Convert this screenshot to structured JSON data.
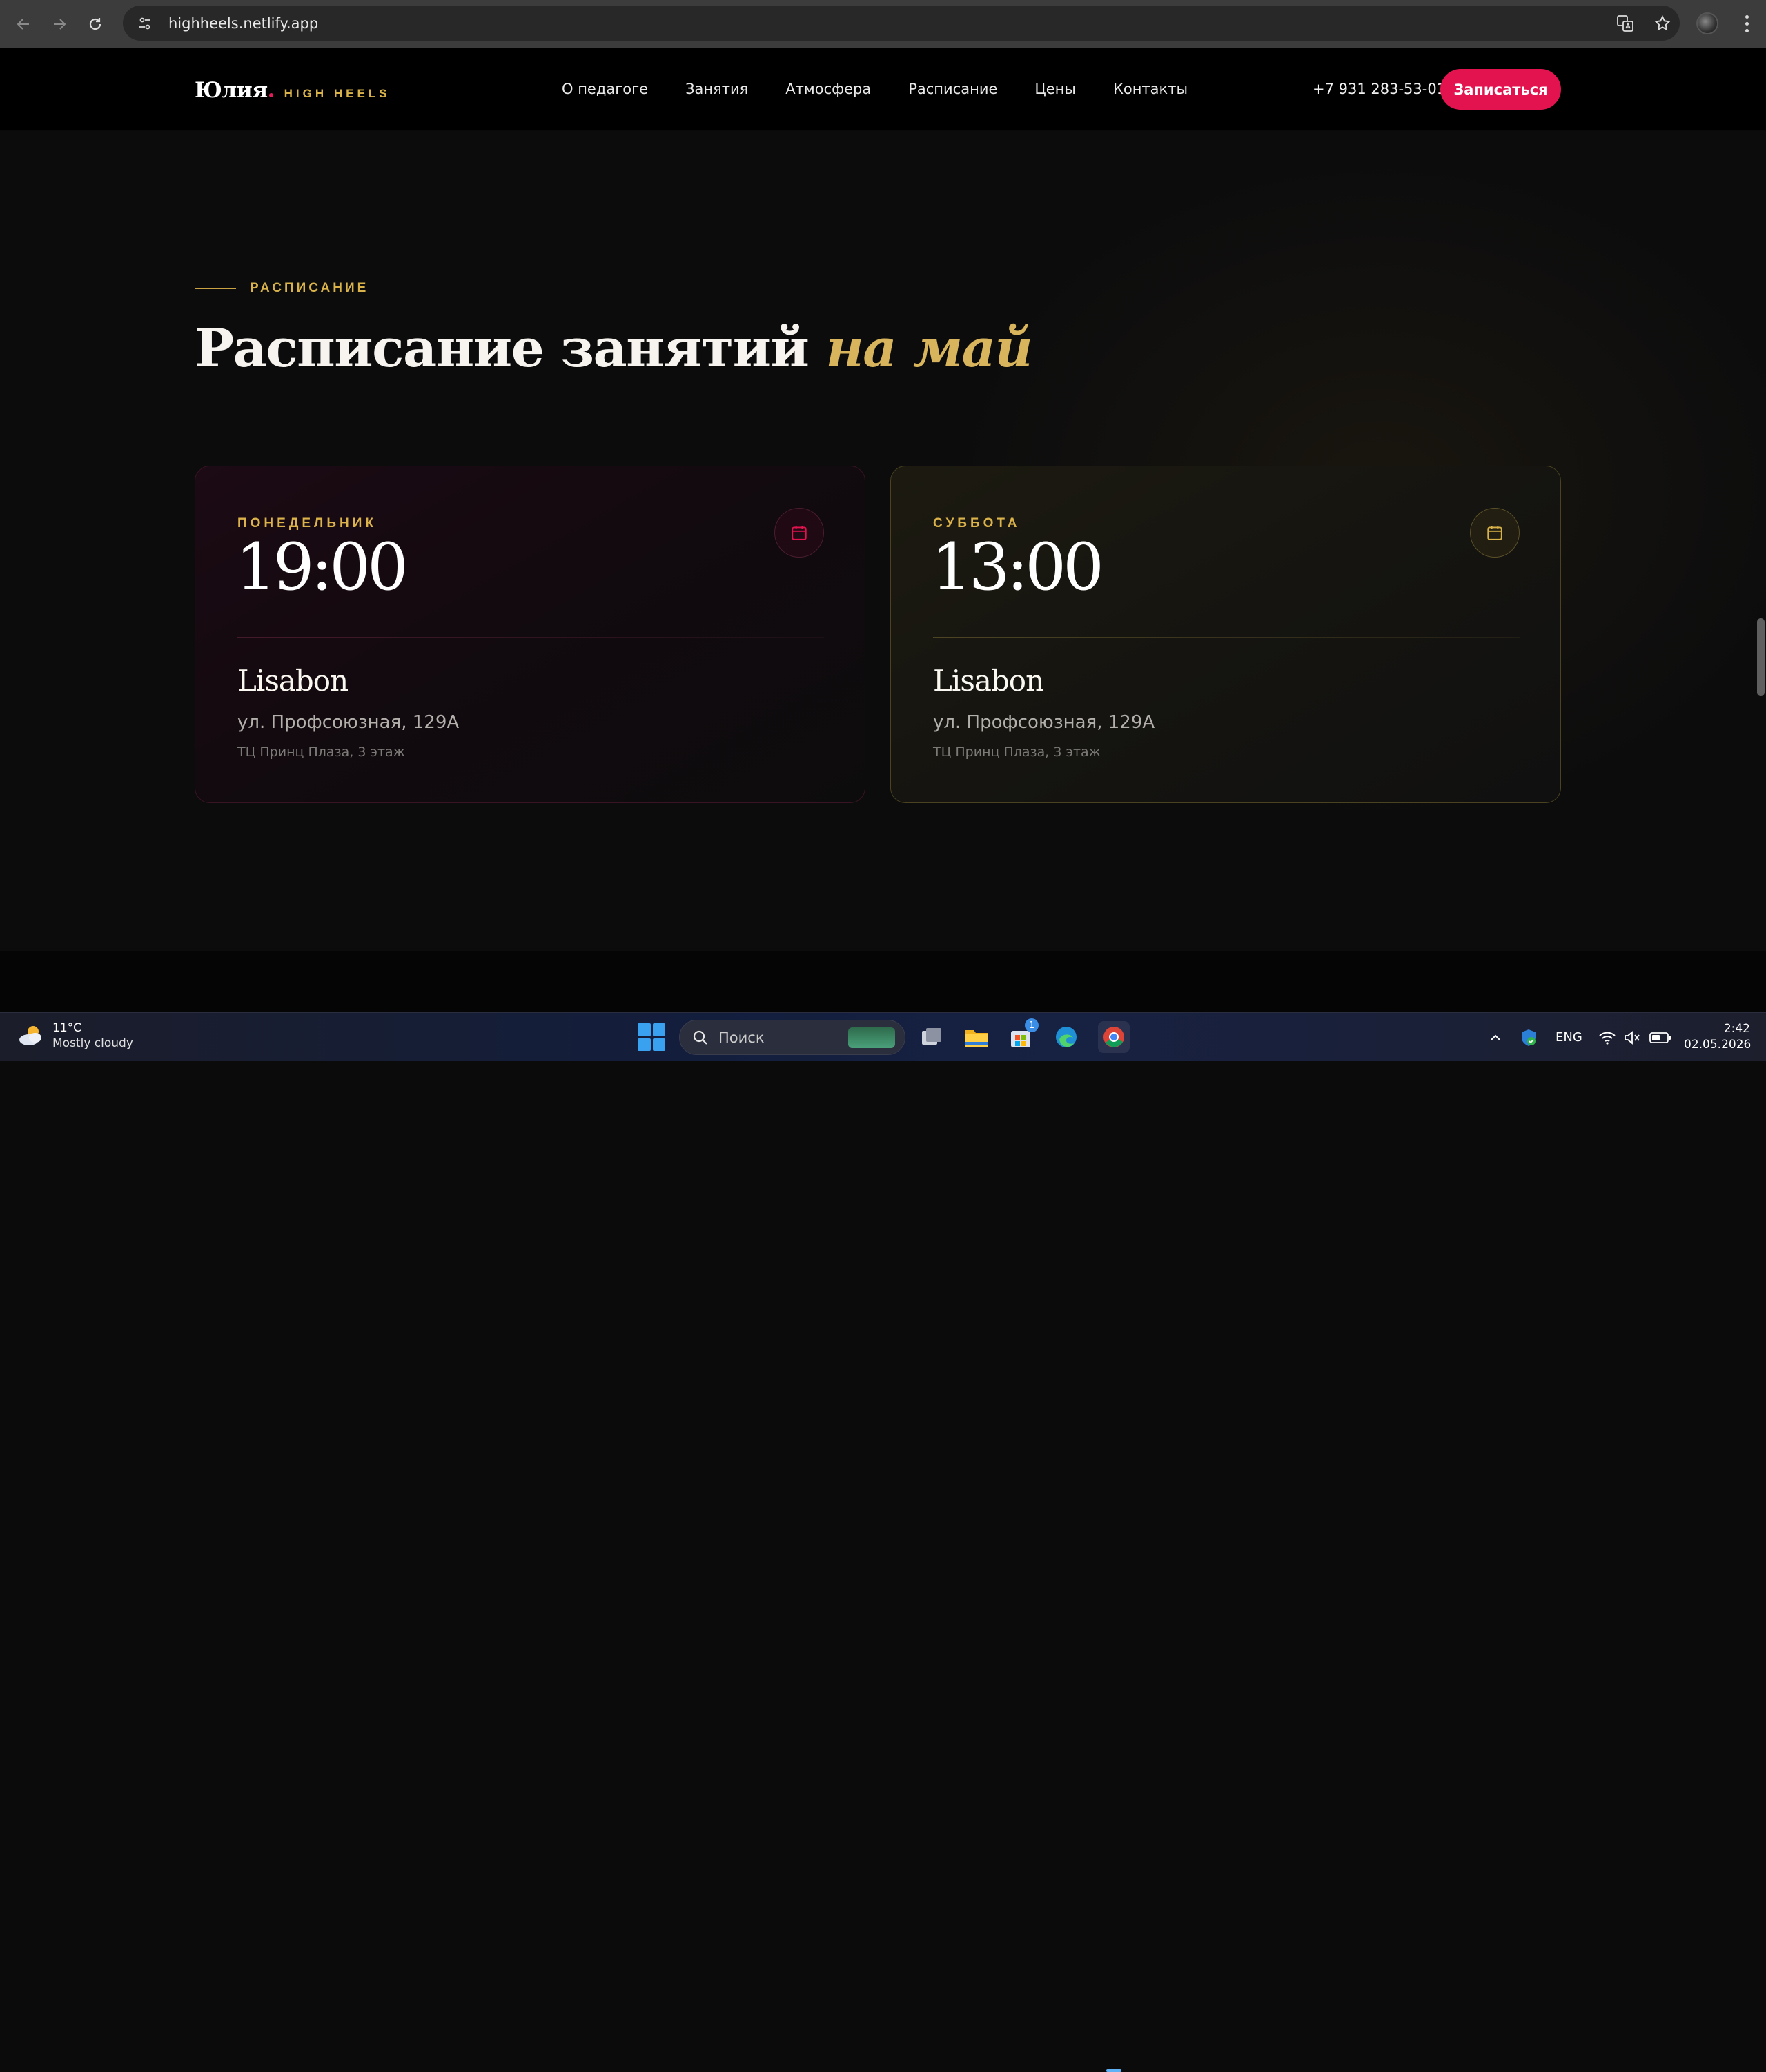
{
  "browser": {
    "url": "highheels.netlify.app"
  },
  "header": {
    "logo_name": "Юлия",
    "logo_subtitle": "HIGH HEELS",
    "nav": [
      {
        "label": "О педагоге"
      },
      {
        "label": "Занятия"
      },
      {
        "label": "Атмосфера"
      },
      {
        "label": "Расписание"
      },
      {
        "label": "Цены"
      },
      {
        "label": "Контакты"
      }
    ],
    "phone": "+7 931 283-53-01",
    "cta_label": "Записаться"
  },
  "schedule": {
    "eyebrow": "РАСПИСАНИЕ",
    "title_main": "Расписание занятий ",
    "title_accent": "на май",
    "cards": [
      {
        "day": "ПОНЕДЕЛЬНИК",
        "time": "19:00",
        "place": "Lisabon",
        "address": "ул. Профсоюзная, 129А",
        "note": "ТЦ Принц Плаза, 3 этаж",
        "icon": "calendar-icon",
        "accent_color": "#e2134f"
      },
      {
        "day": "СУББОТА",
        "time": "13:00",
        "place": "Lisabon",
        "address": "ул. Профсоюзная, 129А",
        "note": "ТЦ Принц Плаза, 3 этаж",
        "icon": "calendar-icon",
        "accent_color": "#d9b34a"
      }
    ]
  },
  "taskbar": {
    "weather_temp": "11°C",
    "weather_desc": "Mostly cloudy",
    "search_placeholder": "Поиск",
    "store_badge": "1",
    "language": "ENG",
    "time": "2:42",
    "date": "02.05.2026"
  },
  "colors": {
    "brand_pink": "#e2134f",
    "gold": "#d9b34a",
    "background": "#0c0c0d"
  }
}
